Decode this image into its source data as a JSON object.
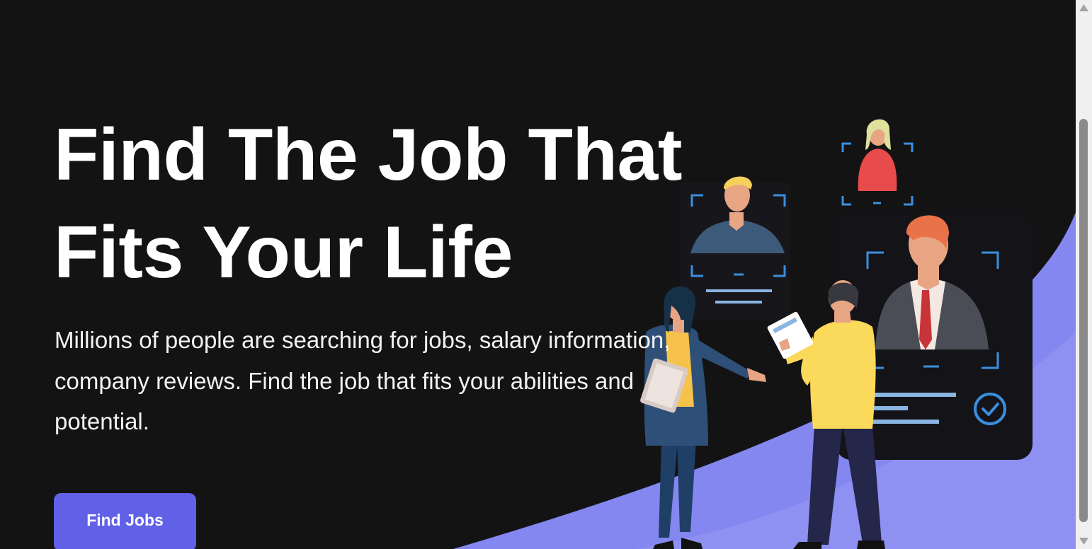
{
  "hero": {
    "title_line1": "Find The Job That",
    "title_line2": "Fits Your Life",
    "subtitle": "Millions of people are searching for jobs, salary information, company reviews. Find the job that fits your abilities and potential.",
    "cta_label": "Find Jobs"
  },
  "colors": {
    "background": "#131313",
    "accent": "#6161e8",
    "wave": "#8487f0",
    "frame_blue": "#3a8fe0"
  },
  "icons": {
    "check": "check-circle-icon",
    "scroll_up": "triangle-up-icon",
    "scroll_down": "triangle-down-icon"
  }
}
